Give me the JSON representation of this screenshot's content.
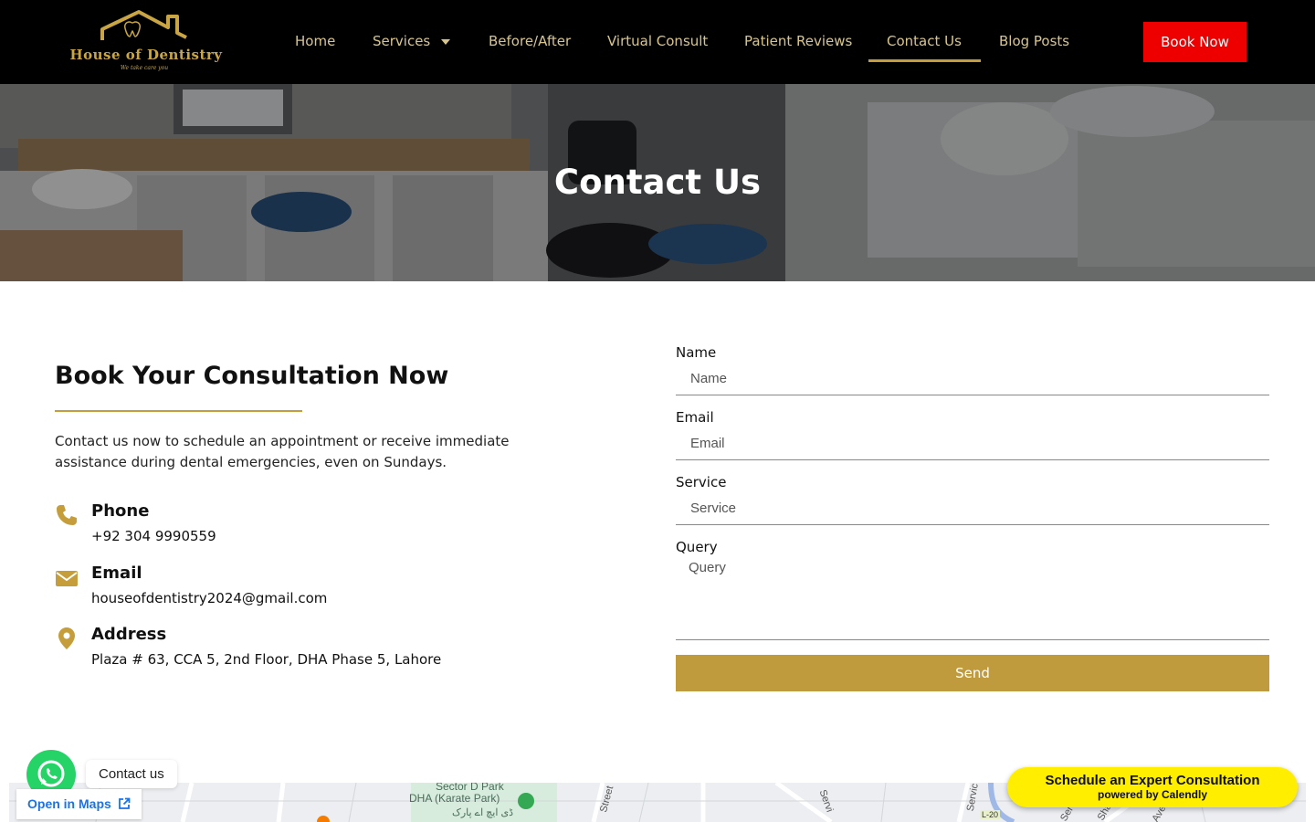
{
  "nav": {
    "logo_name": "House of Dentistry",
    "logo_tagline": "We take care you",
    "items": [
      "Home",
      "Services",
      "Before/After",
      "Virtual Consult",
      "Patient Reviews",
      "Contact Us",
      "Blog Posts"
    ],
    "active": "Contact Us",
    "book_label": "Book Now",
    "accent": "#c59d3a",
    "book_color": "#ee0000"
  },
  "hero": {
    "title": "Contact Us"
  },
  "info": {
    "heading": "Book Your Consultation Now",
    "intro": "Contact us now to schedule an appointment or receive immediate assistance during dental emergencies, even on Sundays.",
    "phone_title": "Phone",
    "phone": "+92 304 9990559",
    "email_title": "Email",
    "email": "houseofdentistry2024@gmail.com",
    "address_title": "Address",
    "address": "Plaza # 63, CCA 5, 2nd Floor, DHA Phase 5, Lahore"
  },
  "form": {
    "name_label": "Name",
    "name_placeholder": "Name",
    "email_label": "Email",
    "email_placeholder": "Email",
    "service_label": "Service",
    "service_placeholder": "Service",
    "query_label": "Query",
    "query_placeholder": "Query",
    "send_label": "Send"
  },
  "widgets": {
    "whatsapp_label": "Contact us",
    "maps_label": "Open in Maps",
    "calendly_title": "Schedule an Expert Consultation",
    "calendly_sub": "powered by Calendly"
  },
  "map": {
    "labels": [
      "Sector D Park",
      "DHA (Karate Park)",
      "ڈی ایچ اے پارک",
      "Street",
      "Servi",
      "Servic",
      "L-20",
      "Ser",
      "Sha",
      "Ave"
    ]
  }
}
